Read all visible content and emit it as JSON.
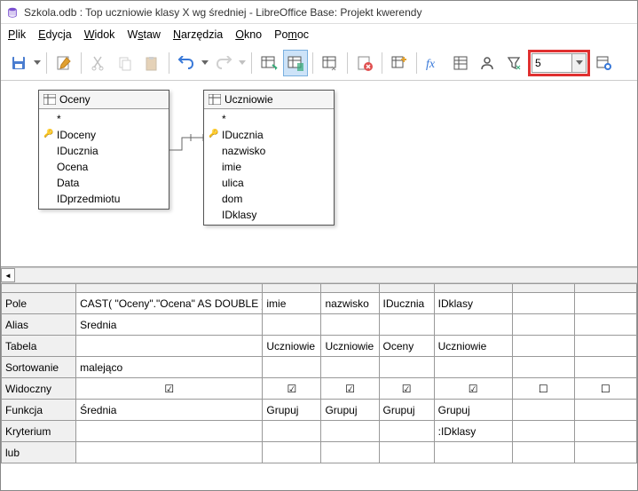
{
  "title": "Szkola.odb : Top uczniowie klasy X wg średniej - LibreOffice Base: Projekt kwerendy",
  "menu": [
    "Plik",
    "Edycja",
    "Widok",
    "Wstaw",
    "Narzędzia",
    "Okno",
    "Pomoc"
  ],
  "limit_value": "5",
  "tables": {
    "oceny": {
      "title": "Oceny",
      "fields": [
        "*",
        "IDoceny",
        "IDucznia",
        "Ocena",
        "Data",
        "IDprzedmiotu"
      ],
      "pk_index": 1
    },
    "uczniowie": {
      "title": "Uczniowie",
      "fields": [
        "*",
        "IDucznia",
        "nazwisko",
        "imie",
        "ulica",
        "dom",
        "IDklasy"
      ],
      "pk_index": 1
    }
  },
  "grid": {
    "labels": {
      "pole": "Pole",
      "alias": "Alias",
      "tabela": "Tabela",
      "sort": "Sortowanie",
      "widoczny": "Widoczny",
      "funkcja": "Funkcja",
      "kryterium": "Kryterium",
      "lub": "lub"
    },
    "cols": [
      {
        "pole": "CAST( \"Oceny\".\"Ocena\" AS DOUBLE )",
        "alias": "Srednia",
        "tabela": "",
        "sort": "malejąco",
        "widoczny": true,
        "funkcja": "Średnia",
        "kryterium": ""
      },
      {
        "pole": "imie",
        "alias": "",
        "tabela": "Uczniowie",
        "sort": "",
        "widoczny": true,
        "funkcja": "Grupuj",
        "kryterium": ""
      },
      {
        "pole": "nazwisko",
        "alias": "",
        "tabela": "Uczniowie",
        "sort": "",
        "widoczny": true,
        "funkcja": "Grupuj",
        "kryterium": ""
      },
      {
        "pole": "IDucznia",
        "alias": "",
        "tabela": "Oceny",
        "sort": "",
        "widoczny": true,
        "funkcja": "Grupuj",
        "kryterium": ""
      },
      {
        "pole": "IDklasy",
        "alias": "",
        "tabela": "Uczniowie",
        "sort": "",
        "widoczny": true,
        "funkcja": "Grupuj",
        "kryterium": ":IDklasy"
      },
      {
        "pole": "",
        "alias": "",
        "tabela": "",
        "sort": "",
        "widoczny": false,
        "funkcja": "",
        "kryterium": ""
      },
      {
        "pole": "",
        "alias": "",
        "tabela": "",
        "sort": "",
        "widoczny": false,
        "funkcja": "",
        "kryterium": ""
      }
    ]
  }
}
